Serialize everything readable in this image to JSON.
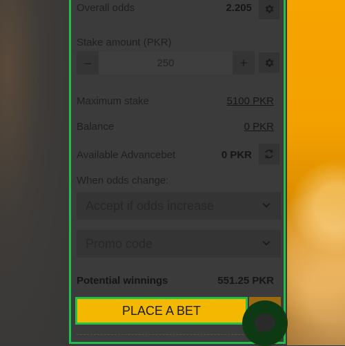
{
  "coupon": {
    "overall_odds_label": "Overall odds",
    "overall_odds_value": "2.205",
    "stake_label": "Stake amount (PKR)",
    "stake_minus": "–",
    "stake_value": "250",
    "stake_plus": "+",
    "max_stake_label": "Maximum stake",
    "max_stake_value": "5100 PKR",
    "balance_label": "Balance",
    "balance_value": "0 PKR",
    "advancebet_label": "Available Advancebet",
    "advancebet_value": "0 PKR",
    "odds_change_label": "When odds change:",
    "odds_change_selected": "Accept if odds increase",
    "promo_placeholder": "Promo code",
    "potential_label": "Potential winnings",
    "potential_value": "551.25 PKR",
    "place_bet_label": "PLACE A BET"
  },
  "icons": {
    "settings": "gear-icon",
    "refresh": "refresh-icon",
    "dropdown": "chevron-down-icon",
    "chat": "chat-icon"
  },
  "colors": {
    "accent_green": "#1fbf4a",
    "button_yellow": "#f4b800"
  }
}
